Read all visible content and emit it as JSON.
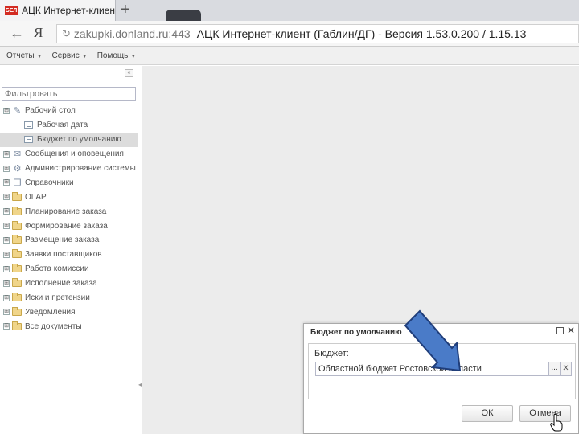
{
  "browser": {
    "tab_title": "АЦК Интернет-клиент",
    "favicon_text": "БЕЛ",
    "new_tab_symbol": "+",
    "back_symbol": "←",
    "yandex_symbol": "Я",
    "reload_symbol": "↻",
    "url_domain": "zakupki.donland.ru:443",
    "url_title": "АЦК Интернет-клиент (Габлин/ДГ) - Версия 1.53.0.200 / 1.15.13"
  },
  "menu": {
    "items": [
      "Отчеты",
      "Сервис",
      "Помощь"
    ],
    "caret": "▼"
  },
  "sidebar": {
    "collapse_symbol": "«",
    "filter_placeholder": "Фильтровать",
    "tree": [
      {
        "label": "Рабочий стол",
        "expander": "⊟",
        "icon": "desktop-icon",
        "level": 0
      },
      {
        "label": "Рабочая дата",
        "icon": "form-icon",
        "level": 1
      },
      {
        "label": "Бюджет по умолчанию",
        "icon": "form-icon",
        "level": 1,
        "selected": true
      },
      {
        "label": "Сообщения и оповещения",
        "expander": "⊞",
        "icon": "messages-icon",
        "level": 0
      },
      {
        "label": "Администрирование системы",
        "expander": "⊞",
        "icon": "admin-icon",
        "level": 0
      },
      {
        "label": "Справочники",
        "expander": "⊞",
        "icon": "books-icon",
        "level": 0
      },
      {
        "label": "OLAP",
        "expander": "⊞",
        "icon": "folder-icon",
        "level": 0
      },
      {
        "label": "Планирование заказа",
        "expander": "⊞",
        "icon": "folder-icon",
        "level": 0
      },
      {
        "label": "Формирование заказа",
        "expander": "⊞",
        "icon": "folder-icon",
        "level": 0
      },
      {
        "label": "Размещение заказа",
        "expander": "⊞",
        "icon": "folder-icon",
        "level": 0
      },
      {
        "label": "Заявки поставщиков",
        "expander": "⊞",
        "icon": "folder-icon",
        "level": 0
      },
      {
        "label": "Работа комиссии",
        "expander": "⊞",
        "icon": "folder-icon",
        "level": 0
      },
      {
        "label": "Исполнение заказа",
        "expander": "⊞",
        "icon": "folder-icon",
        "level": 0
      },
      {
        "label": "Иски и претензии",
        "expander": "⊞",
        "icon": "folder-icon",
        "level": 0
      },
      {
        "label": "Уведомления",
        "expander": "⊞",
        "icon": "folder-icon",
        "level": 0
      },
      {
        "label": "Все документы",
        "expander": "⊞",
        "icon": "folder-icon",
        "level": 0
      }
    ]
  },
  "dialog": {
    "title": "Бюджет по умолчанию",
    "field_label": "Бюджет:",
    "field_value": "Областной бюджет Ростовской области",
    "dots_label": "...",
    "clear_symbol": "✕",
    "close_symbol": "✕",
    "ok_label": "ОК",
    "cancel_label": "Отмена"
  },
  "colors": {
    "arrow_fill": "#4a7bc8",
    "arrow_stroke": "#1f3d7a",
    "favicon_bg": "#d32b22"
  }
}
